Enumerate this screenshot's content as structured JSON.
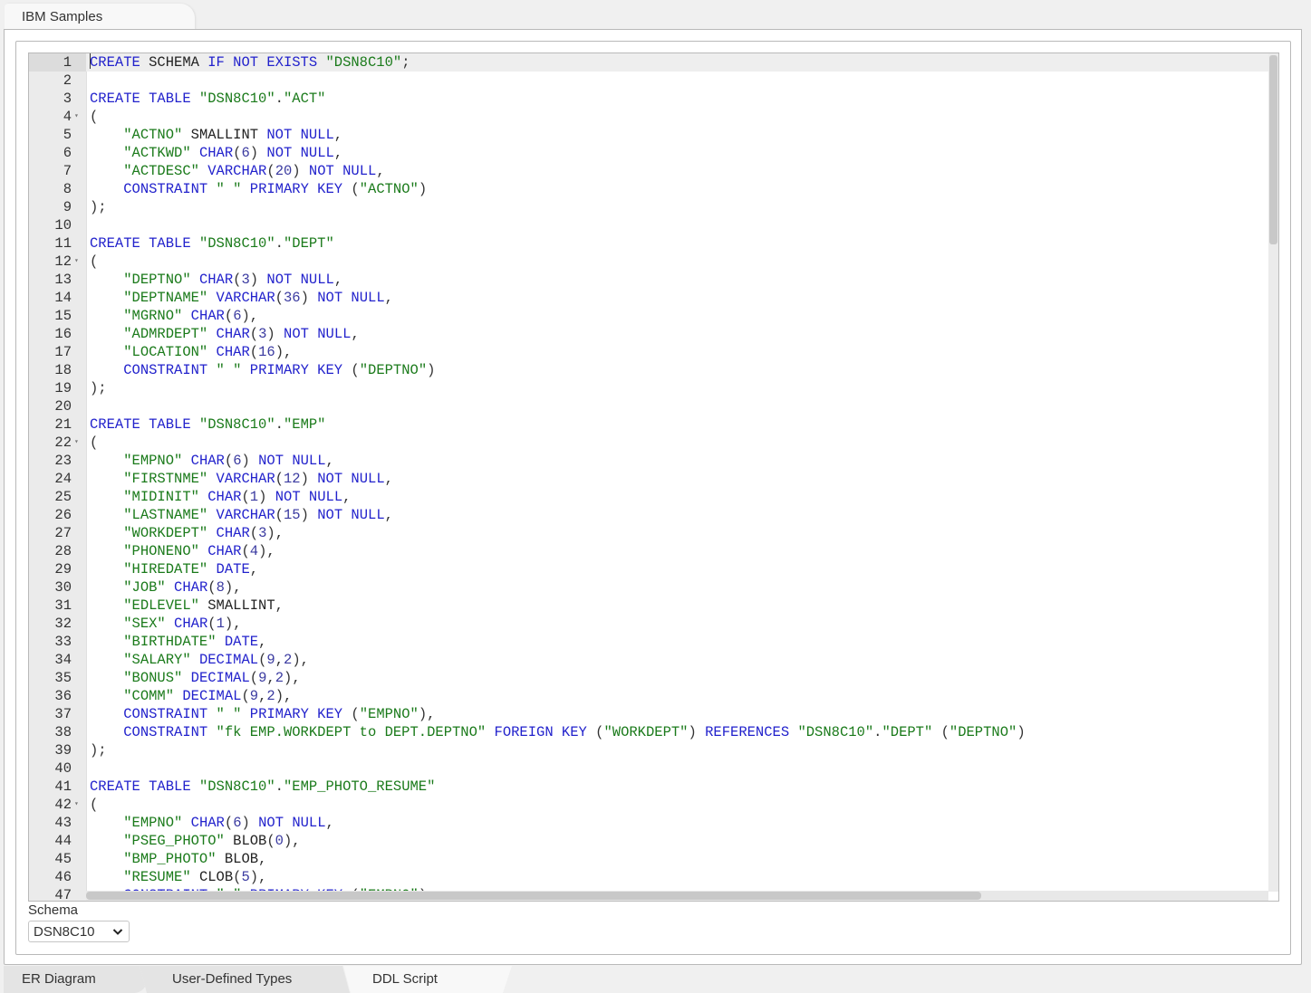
{
  "top_tab": {
    "label": "IBM Samples"
  },
  "editor": {
    "active_line": 1,
    "fold_lines": [
      4,
      12,
      22,
      42
    ],
    "lines": [
      [
        [
          "kw",
          "CREATE"
        ],
        [
          "id",
          " SCHEMA "
        ],
        [
          "kw",
          "IF NOT EXISTS"
        ],
        [
          "id",
          " "
        ],
        [
          "str",
          "\"DSN8C10\""
        ],
        [
          "punc",
          ";"
        ]
      ],
      [],
      [
        [
          "kw",
          "CREATE TABLE"
        ],
        [
          "id",
          " "
        ],
        [
          "str",
          "\"DSN8C10\""
        ],
        [
          "punc",
          "."
        ],
        [
          "str",
          "\"ACT\""
        ]
      ],
      [
        [
          "punc",
          "("
        ]
      ],
      [
        [
          "id",
          "    "
        ],
        [
          "str",
          "\"ACTNO\""
        ],
        [
          "id",
          " SMALLINT "
        ],
        [
          "kw",
          "NOT NULL"
        ],
        [
          "punc",
          ","
        ]
      ],
      [
        [
          "id",
          "    "
        ],
        [
          "str",
          "\"ACTKWD\""
        ],
        [
          "id",
          " "
        ],
        [
          "kw",
          "CHAR"
        ],
        [
          "punc",
          "("
        ],
        [
          "num",
          "6"
        ],
        [
          "punc",
          ")"
        ],
        [
          "id",
          " "
        ],
        [
          "kw",
          "NOT NULL"
        ],
        [
          "punc",
          ","
        ]
      ],
      [
        [
          "id",
          "    "
        ],
        [
          "str",
          "\"ACTDESC\""
        ],
        [
          "id",
          " "
        ],
        [
          "kw",
          "VARCHAR"
        ],
        [
          "punc",
          "("
        ],
        [
          "num",
          "20"
        ],
        [
          "punc",
          ")"
        ],
        [
          "id",
          " "
        ],
        [
          "kw",
          "NOT NULL"
        ],
        [
          "punc",
          ","
        ]
      ],
      [
        [
          "id",
          "    "
        ],
        [
          "kw",
          "CONSTRAINT"
        ],
        [
          "id",
          " "
        ],
        [
          "str",
          "\" \""
        ],
        [
          "id",
          " "
        ],
        [
          "kw",
          "PRIMARY KEY"
        ],
        [
          "id",
          " "
        ],
        [
          "punc",
          "("
        ],
        [
          "str",
          "\"ACTNO\""
        ],
        [
          "punc",
          ")"
        ]
      ],
      [
        [
          "punc",
          ");"
        ]
      ],
      [],
      [
        [
          "kw",
          "CREATE TABLE"
        ],
        [
          "id",
          " "
        ],
        [
          "str",
          "\"DSN8C10\""
        ],
        [
          "punc",
          "."
        ],
        [
          "str",
          "\"DEPT\""
        ]
      ],
      [
        [
          "punc",
          "("
        ]
      ],
      [
        [
          "id",
          "    "
        ],
        [
          "str",
          "\"DEPTNO\""
        ],
        [
          "id",
          " "
        ],
        [
          "kw",
          "CHAR"
        ],
        [
          "punc",
          "("
        ],
        [
          "num",
          "3"
        ],
        [
          "punc",
          ")"
        ],
        [
          "id",
          " "
        ],
        [
          "kw",
          "NOT NULL"
        ],
        [
          "punc",
          ","
        ]
      ],
      [
        [
          "id",
          "    "
        ],
        [
          "str",
          "\"DEPTNAME\""
        ],
        [
          "id",
          " "
        ],
        [
          "kw",
          "VARCHAR"
        ],
        [
          "punc",
          "("
        ],
        [
          "num",
          "36"
        ],
        [
          "punc",
          ")"
        ],
        [
          "id",
          " "
        ],
        [
          "kw",
          "NOT NULL"
        ],
        [
          "punc",
          ","
        ]
      ],
      [
        [
          "id",
          "    "
        ],
        [
          "str",
          "\"MGRNO\""
        ],
        [
          "id",
          " "
        ],
        [
          "kw",
          "CHAR"
        ],
        [
          "punc",
          "("
        ],
        [
          "num",
          "6"
        ],
        [
          "punc",
          "),"
        ]
      ],
      [
        [
          "id",
          "    "
        ],
        [
          "str",
          "\"ADMRDEPT\""
        ],
        [
          "id",
          " "
        ],
        [
          "kw",
          "CHAR"
        ],
        [
          "punc",
          "("
        ],
        [
          "num",
          "3"
        ],
        [
          "punc",
          ")"
        ],
        [
          "id",
          " "
        ],
        [
          "kw",
          "NOT NULL"
        ],
        [
          "punc",
          ","
        ]
      ],
      [
        [
          "id",
          "    "
        ],
        [
          "str",
          "\"LOCATION\""
        ],
        [
          "id",
          " "
        ],
        [
          "kw",
          "CHAR"
        ],
        [
          "punc",
          "("
        ],
        [
          "num",
          "16"
        ],
        [
          "punc",
          "),"
        ]
      ],
      [
        [
          "id",
          "    "
        ],
        [
          "kw",
          "CONSTRAINT"
        ],
        [
          "id",
          " "
        ],
        [
          "str",
          "\" \""
        ],
        [
          "id",
          " "
        ],
        [
          "kw",
          "PRIMARY KEY"
        ],
        [
          "id",
          " "
        ],
        [
          "punc",
          "("
        ],
        [
          "str",
          "\"DEPTNO\""
        ],
        [
          "punc",
          ")"
        ]
      ],
      [
        [
          "punc",
          ");"
        ]
      ],
      [],
      [
        [
          "kw",
          "CREATE TABLE"
        ],
        [
          "id",
          " "
        ],
        [
          "str",
          "\"DSN8C10\""
        ],
        [
          "punc",
          "."
        ],
        [
          "str",
          "\"EMP\""
        ]
      ],
      [
        [
          "punc",
          "("
        ]
      ],
      [
        [
          "id",
          "    "
        ],
        [
          "str",
          "\"EMPNO\""
        ],
        [
          "id",
          " "
        ],
        [
          "kw",
          "CHAR"
        ],
        [
          "punc",
          "("
        ],
        [
          "num",
          "6"
        ],
        [
          "punc",
          ")"
        ],
        [
          "id",
          " "
        ],
        [
          "kw",
          "NOT NULL"
        ],
        [
          "punc",
          ","
        ]
      ],
      [
        [
          "id",
          "    "
        ],
        [
          "str",
          "\"FIRSTNME\""
        ],
        [
          "id",
          " "
        ],
        [
          "kw",
          "VARCHAR"
        ],
        [
          "punc",
          "("
        ],
        [
          "num",
          "12"
        ],
        [
          "punc",
          ")"
        ],
        [
          "id",
          " "
        ],
        [
          "kw",
          "NOT NULL"
        ],
        [
          "punc",
          ","
        ]
      ],
      [
        [
          "id",
          "    "
        ],
        [
          "str",
          "\"MIDINIT\""
        ],
        [
          "id",
          " "
        ],
        [
          "kw",
          "CHAR"
        ],
        [
          "punc",
          "("
        ],
        [
          "num",
          "1"
        ],
        [
          "punc",
          ")"
        ],
        [
          "id",
          " "
        ],
        [
          "kw",
          "NOT NULL"
        ],
        [
          "punc",
          ","
        ]
      ],
      [
        [
          "id",
          "    "
        ],
        [
          "str",
          "\"LASTNAME\""
        ],
        [
          "id",
          " "
        ],
        [
          "kw",
          "VARCHAR"
        ],
        [
          "punc",
          "("
        ],
        [
          "num",
          "15"
        ],
        [
          "punc",
          ")"
        ],
        [
          "id",
          " "
        ],
        [
          "kw",
          "NOT NULL"
        ],
        [
          "punc",
          ","
        ]
      ],
      [
        [
          "id",
          "    "
        ],
        [
          "str",
          "\"WORKDEPT\""
        ],
        [
          "id",
          " "
        ],
        [
          "kw",
          "CHAR"
        ],
        [
          "punc",
          "("
        ],
        [
          "num",
          "3"
        ],
        [
          "punc",
          "),"
        ]
      ],
      [
        [
          "id",
          "    "
        ],
        [
          "str",
          "\"PHONENO\""
        ],
        [
          "id",
          " "
        ],
        [
          "kw",
          "CHAR"
        ],
        [
          "punc",
          "("
        ],
        [
          "num",
          "4"
        ],
        [
          "punc",
          "),"
        ]
      ],
      [
        [
          "id",
          "    "
        ],
        [
          "str",
          "\"HIREDATE\""
        ],
        [
          "id",
          " "
        ],
        [
          "kw",
          "DATE"
        ],
        [
          "punc",
          ","
        ]
      ],
      [
        [
          "id",
          "    "
        ],
        [
          "str",
          "\"JOB\""
        ],
        [
          "id",
          " "
        ],
        [
          "kw",
          "CHAR"
        ],
        [
          "punc",
          "("
        ],
        [
          "num",
          "8"
        ],
        [
          "punc",
          "),"
        ]
      ],
      [
        [
          "id",
          "    "
        ],
        [
          "str",
          "\"EDLEVEL\""
        ],
        [
          "id",
          " SMALLINT"
        ],
        [
          "punc",
          ","
        ]
      ],
      [
        [
          "id",
          "    "
        ],
        [
          "str",
          "\"SEX\""
        ],
        [
          "id",
          " "
        ],
        [
          "kw",
          "CHAR"
        ],
        [
          "punc",
          "("
        ],
        [
          "num",
          "1"
        ],
        [
          "punc",
          "),"
        ]
      ],
      [
        [
          "id",
          "    "
        ],
        [
          "str",
          "\"BIRTHDATE\""
        ],
        [
          "id",
          " "
        ],
        [
          "kw",
          "DATE"
        ],
        [
          "punc",
          ","
        ]
      ],
      [
        [
          "id",
          "    "
        ],
        [
          "str",
          "\"SALARY\""
        ],
        [
          "id",
          " "
        ],
        [
          "kw",
          "DECIMAL"
        ],
        [
          "punc",
          "("
        ],
        [
          "num",
          "9"
        ],
        [
          "punc",
          ","
        ],
        [
          "num",
          "2"
        ],
        [
          "punc",
          "),"
        ]
      ],
      [
        [
          "id",
          "    "
        ],
        [
          "str",
          "\"BONUS\""
        ],
        [
          "id",
          " "
        ],
        [
          "kw",
          "DECIMAL"
        ],
        [
          "punc",
          "("
        ],
        [
          "num",
          "9"
        ],
        [
          "punc",
          ","
        ],
        [
          "num",
          "2"
        ],
        [
          "punc",
          "),"
        ]
      ],
      [
        [
          "id",
          "    "
        ],
        [
          "str",
          "\"COMM\""
        ],
        [
          "id",
          " "
        ],
        [
          "kw",
          "DECIMAL"
        ],
        [
          "punc",
          "("
        ],
        [
          "num",
          "9"
        ],
        [
          "punc",
          ","
        ],
        [
          "num",
          "2"
        ],
        [
          "punc",
          "),"
        ]
      ],
      [
        [
          "id",
          "    "
        ],
        [
          "kw",
          "CONSTRAINT"
        ],
        [
          "id",
          " "
        ],
        [
          "str",
          "\" \""
        ],
        [
          "id",
          " "
        ],
        [
          "kw",
          "PRIMARY KEY"
        ],
        [
          "id",
          " "
        ],
        [
          "punc",
          "("
        ],
        [
          "str",
          "\"EMPNO\""
        ],
        [
          "punc",
          "),"
        ]
      ],
      [
        [
          "id",
          "    "
        ],
        [
          "kw",
          "CONSTRAINT"
        ],
        [
          "id",
          " "
        ],
        [
          "str",
          "\"fk EMP.WORKDEPT to DEPT.DEPTNO\""
        ],
        [
          "id",
          " "
        ],
        [
          "kw",
          "FOREIGN KEY"
        ],
        [
          "id",
          " "
        ],
        [
          "punc",
          "("
        ],
        [
          "str",
          "\"WORKDEPT\""
        ],
        [
          "punc",
          ")"
        ],
        [
          "id",
          " "
        ],
        [
          "kw",
          "REFERENCES"
        ],
        [
          "id",
          " "
        ],
        [
          "str",
          "\"DSN8C10\""
        ],
        [
          "punc",
          "."
        ],
        [
          "str",
          "\"DEPT\""
        ],
        [
          "id",
          " "
        ],
        [
          "punc",
          "("
        ],
        [
          "str",
          "\"DEPTNO\""
        ],
        [
          "punc",
          ")"
        ]
      ],
      [
        [
          "punc",
          ");"
        ]
      ],
      [],
      [
        [
          "kw",
          "CREATE TABLE"
        ],
        [
          "id",
          " "
        ],
        [
          "str",
          "\"DSN8C10\""
        ],
        [
          "punc",
          "."
        ],
        [
          "str",
          "\"EMP_PHOTO_RESUME\""
        ]
      ],
      [
        [
          "punc",
          "("
        ]
      ],
      [
        [
          "id",
          "    "
        ],
        [
          "str",
          "\"EMPNO\""
        ],
        [
          "id",
          " "
        ],
        [
          "kw",
          "CHAR"
        ],
        [
          "punc",
          "("
        ],
        [
          "num",
          "6"
        ],
        [
          "punc",
          ")"
        ],
        [
          "id",
          " "
        ],
        [
          "kw",
          "NOT NULL"
        ],
        [
          "punc",
          ","
        ]
      ],
      [
        [
          "id",
          "    "
        ],
        [
          "str",
          "\"PSEG_PHOTO\""
        ],
        [
          "id",
          " BLOB"
        ],
        [
          "punc",
          "("
        ],
        [
          "num",
          "0"
        ],
        [
          "punc",
          "),"
        ]
      ],
      [
        [
          "id",
          "    "
        ],
        [
          "str",
          "\"BMP_PHOTO\""
        ],
        [
          "id",
          " BLOB"
        ],
        [
          "punc",
          ","
        ]
      ],
      [
        [
          "id",
          "    "
        ],
        [
          "str",
          "\"RESUME\""
        ],
        [
          "id",
          " CLOB"
        ],
        [
          "punc",
          "("
        ],
        [
          "num",
          "5"
        ],
        [
          "punc",
          "),"
        ]
      ],
      [
        [
          "id",
          "    "
        ],
        [
          "kw",
          "CONSTRAINT"
        ],
        [
          "id",
          " "
        ],
        [
          "str",
          "\" \""
        ],
        [
          "id",
          " "
        ],
        [
          "kw",
          "PRIMARY KEY"
        ],
        [
          "id",
          " "
        ],
        [
          "punc",
          "("
        ],
        [
          "str",
          "\"EMPNO\""
        ],
        [
          "punc",
          ")"
        ]
      ]
    ]
  },
  "schema": {
    "label": "Schema",
    "selected": "DSN8C10"
  },
  "bottom_tabs": [
    {
      "label": "ER Diagram",
      "active": false
    },
    {
      "label": "User-Defined Types",
      "active": false
    },
    {
      "label": "DDL Script",
      "active": true
    }
  ],
  "icons": {
    "fold": "▾",
    "chevron": "⌄"
  }
}
